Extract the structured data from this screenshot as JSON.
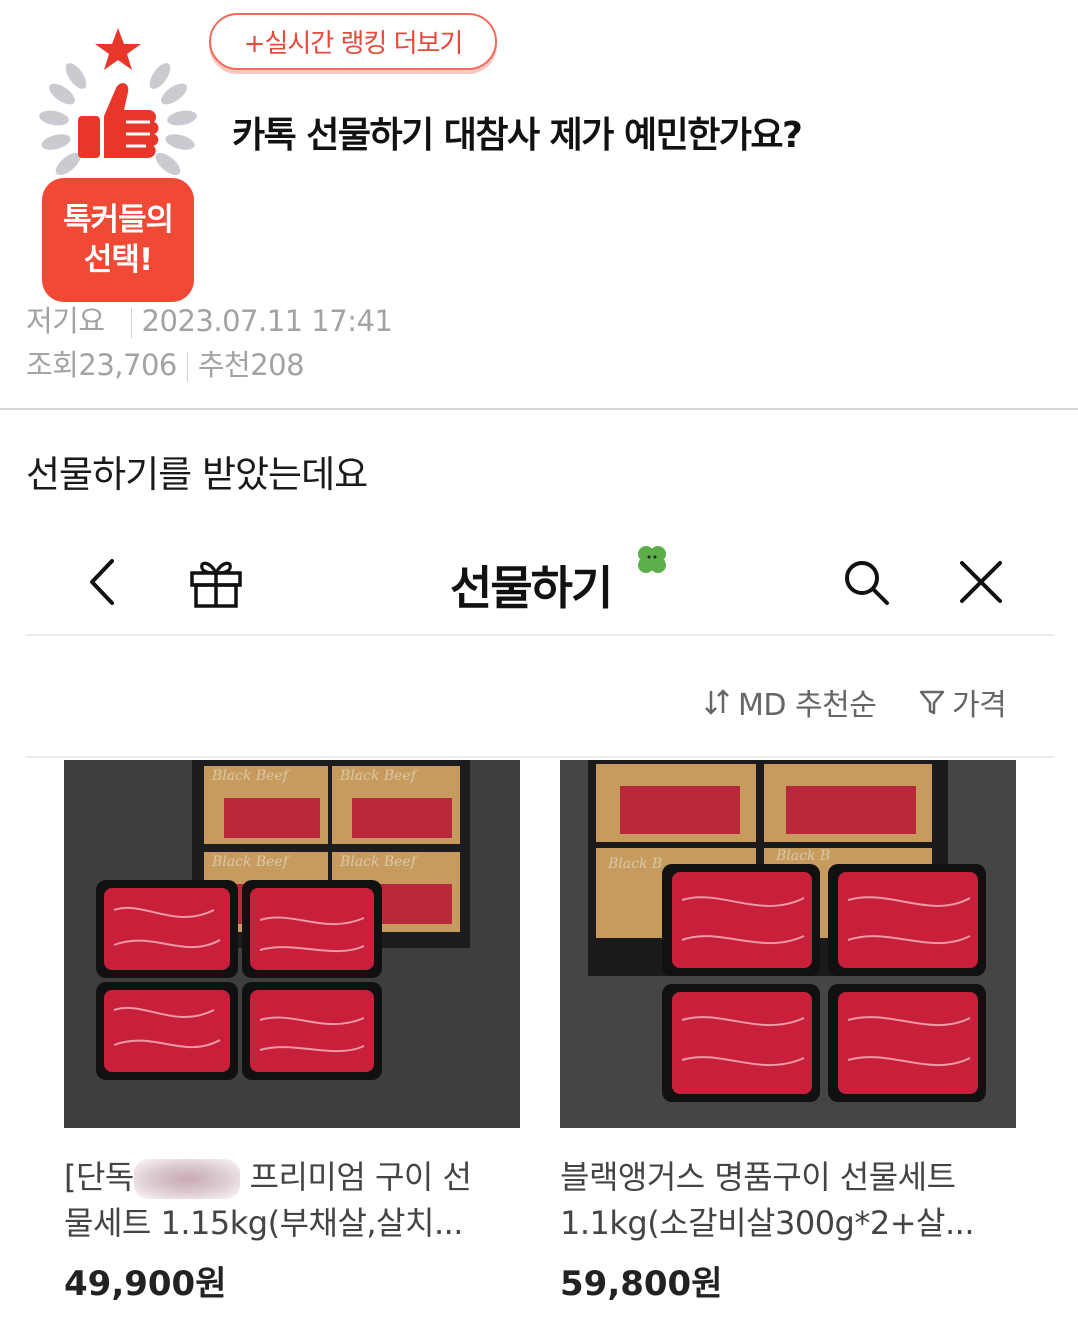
{
  "post": {
    "ranking_button": "+실시간 랭킹 더보기",
    "badge_line1": "톡커들의",
    "badge_line2": "선택!",
    "title": "카톡 선물하기 대참사 제가 예민한가요?",
    "author": "저기요",
    "datetime": "2023.07.11 17:41",
    "views_label": "조회",
    "views": "23,706",
    "recommend_label": "추천",
    "recommend": "208",
    "body": "선물하기를 받았는데요"
  },
  "gift_screen": {
    "nav_title": "선물하기",
    "icons": {
      "back": "chevron-left-icon",
      "gift": "gift-box-icon",
      "search": "search-icon",
      "close": "close-icon",
      "brand": "clover-icon"
    },
    "sort_label": "MD 추천순",
    "filter_label": "가격",
    "products": [
      {
        "name_line1_prefix": "[단독",
        "name_line1_suffix": " 프리미엄 구이 선",
        "name_line2": "물세트 1.15kg(부채살,살치...",
        "price": "49,900원"
      },
      {
        "name_line1": "블랙앵거스 명품구이 선물세트",
        "name_line2": "1.1kg(소갈비살300g*2+살...",
        "price": "59,800원"
      }
    ]
  },
  "colors": {
    "accent_red": "#f04a37",
    "meta_gray": "#a3a3a3"
  }
}
